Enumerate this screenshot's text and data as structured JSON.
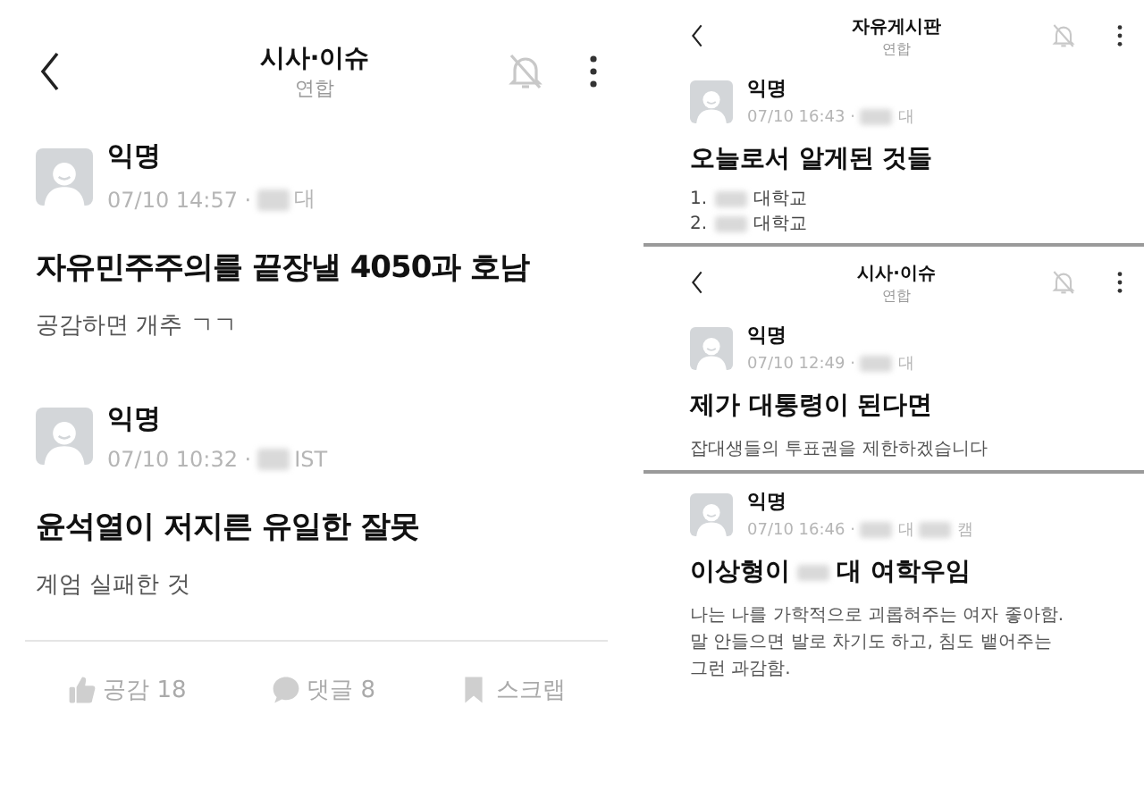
{
  "panels": [
    {
      "header": {
        "title": "시사·이슈",
        "subtitle": "연합"
      },
      "posts": [
        {
          "author": "익명",
          "meta": [
            {
              "kind": "text",
              "text": "07/10 14:57 ·"
            },
            {
              "kind": "blur"
            },
            {
              "kind": "text",
              "text": "대"
            }
          ],
          "title": [
            {
              "kind": "text",
              "text": "자유민주주의를 끝장낼 4050과 호남"
            }
          ],
          "body": "공감하면 개추 ㄱㄱ"
        },
        {
          "author": "익명",
          "meta": [
            {
              "kind": "text",
              "text": "07/10 10:32 ·"
            },
            {
              "kind": "blur"
            },
            {
              "kind": "text",
              "text": "IST"
            }
          ],
          "title": [
            {
              "kind": "text",
              "text": "윤석열이 저지른 유일한 잘못"
            }
          ],
          "body": "계엄 실패한 것"
        }
      ],
      "actions": [
        {
          "kind": "like",
          "label": "공감 18"
        },
        {
          "kind": "comment",
          "label": "댓글 8"
        },
        {
          "kind": "scrap",
          "label": "스크랩"
        }
      ]
    },
    {
      "header": {
        "title": "자유게시판",
        "subtitle": "연합"
      },
      "posts": [
        {
          "author": "익명",
          "meta": [
            {
              "kind": "text",
              "text": "07/10 16:43 ·"
            },
            {
              "kind": "blur"
            },
            {
              "kind": "text",
              "text": "대"
            }
          ],
          "title": [
            {
              "kind": "text",
              "text": "오늘로서 알게된 것들"
            }
          ],
          "list": [
            [
              {
                "kind": "text",
                "text": "1."
              },
              {
                "kind": "blur"
              },
              {
                "kind": "text",
                "text": "대학교"
              }
            ],
            [
              {
                "kind": "text",
                "text": "2."
              },
              {
                "kind": "blur"
              },
              {
                "kind": "text",
                "text": "대학교"
              }
            ]
          ]
        }
      ]
    },
    {
      "header": {
        "title": "시사·이슈",
        "subtitle": "연합"
      },
      "posts": [
        {
          "author": "익명",
          "meta": [
            {
              "kind": "text",
              "text": "07/10 12:49 ·"
            },
            {
              "kind": "blur"
            },
            {
              "kind": "text",
              "text": "대"
            }
          ],
          "title": [
            {
              "kind": "text",
              "text": "제가 대통령이 된다면"
            }
          ],
          "body": "잡대생들의 투표권을 제한하겠습니다"
        }
      ]
    },
    {
      "posts": [
        {
          "author": "익명",
          "meta": [
            {
              "kind": "text",
              "text": "07/10 16:46 ·"
            },
            {
              "kind": "blur"
            },
            {
              "kind": "text",
              "text": "대"
            },
            {
              "kind": "blur"
            },
            {
              "kind": "text",
              "text": "캠"
            }
          ],
          "title": [
            {
              "kind": "text",
              "text": "이상형이"
            },
            {
              "kind": "blur"
            },
            {
              "kind": "text",
              "text": "대 여학우임"
            }
          ],
          "body": "나는 나를 가학적으로 괴롭혀주는 여자 좋아함.\n말 안들으면 발로 차기도 하고, 침도 뱉어주는\n그런 과감함."
        }
      ]
    }
  ]
}
